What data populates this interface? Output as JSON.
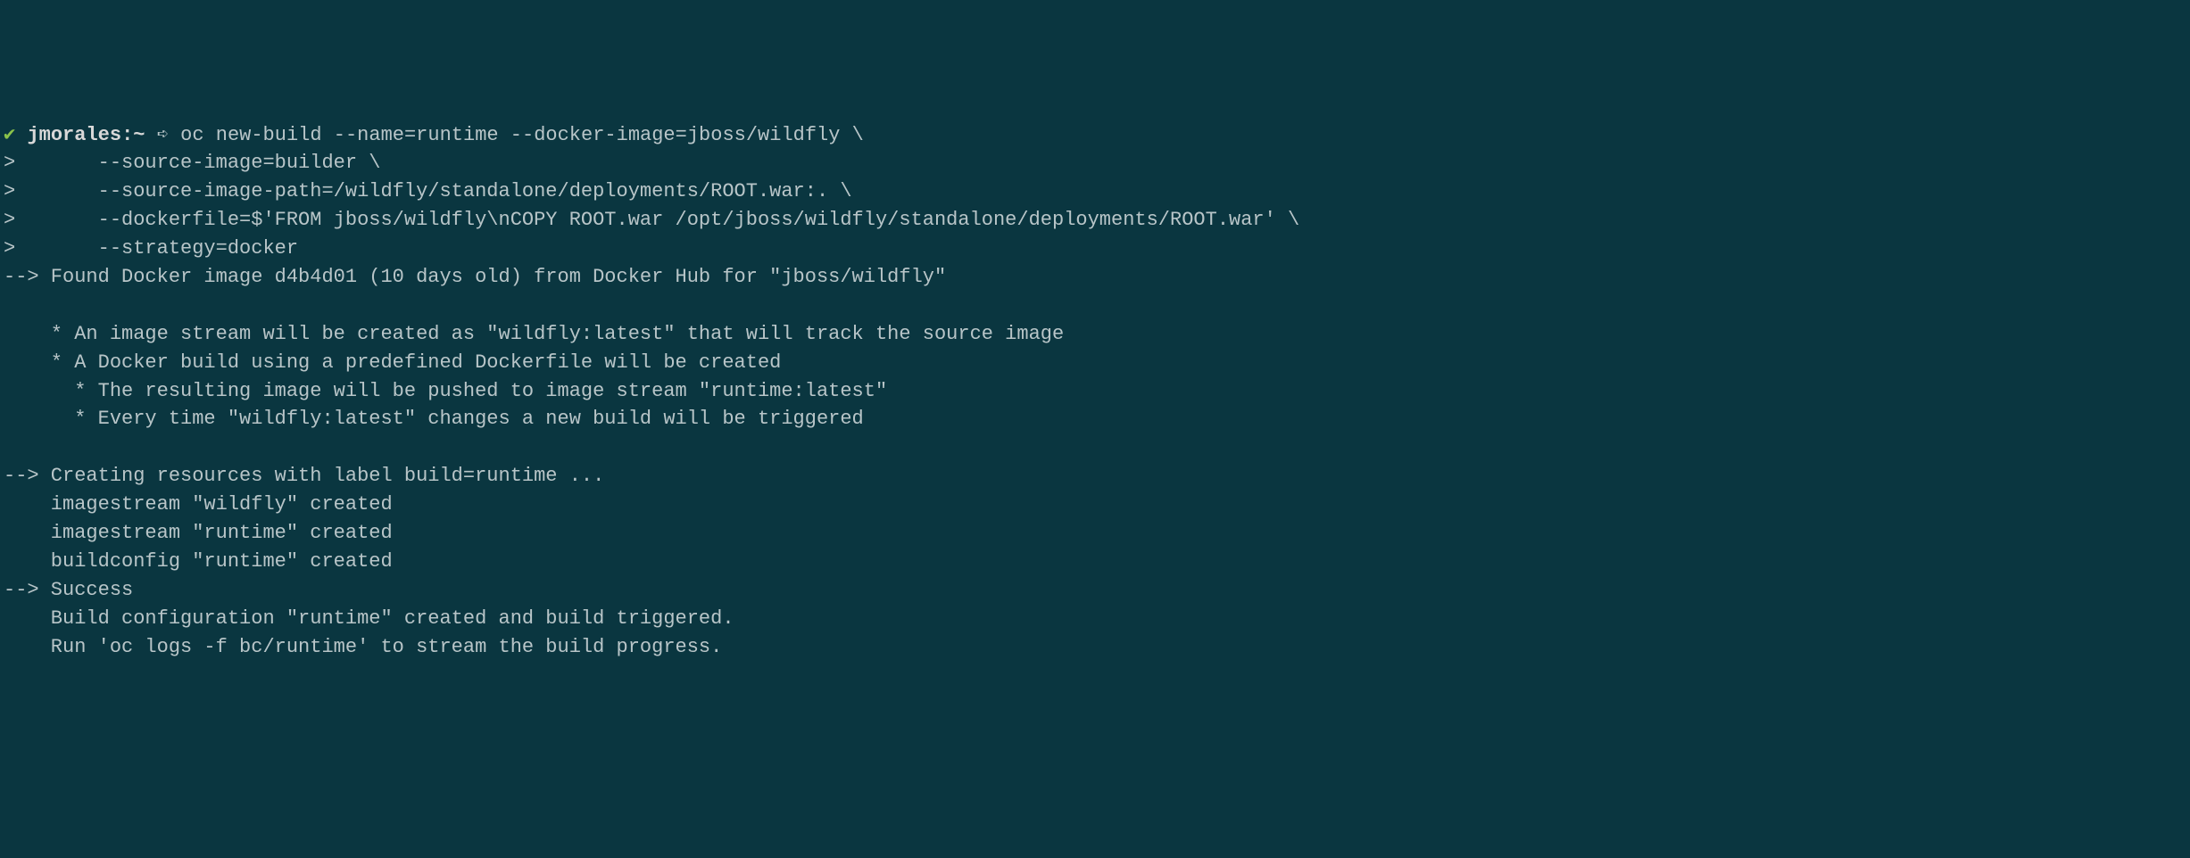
{
  "prompt": {
    "check": "✔",
    "user": "jmorales",
    "separator": ":",
    "path": "~",
    "arrow": "➪"
  },
  "command": {
    "line1": "oc new-build --name=runtime --docker-image=jboss/wildfly \\",
    "line2": ">       --source-image=builder \\",
    "line3": ">       --source-image-path=/wildfly/standalone/deployments/ROOT.war:. \\",
    "line4": ">       --dockerfile=$'FROM jboss/wildfly\\nCOPY ROOT.war /opt/jboss/wildfly/standalone/deployments/ROOT.war' \\",
    "line5": ">       --strategy=docker"
  },
  "output": {
    "found": "--> Found Docker image d4b4d01 (10 days old) from Docker Hub for \"jboss/wildfly\"",
    "blank1": "",
    "bullet1": "    * An image stream will be created as \"wildfly:latest\" that will track the source image",
    "bullet2": "    * A Docker build using a predefined Dockerfile will be created",
    "bullet3": "      * The resulting image will be pushed to image stream \"runtime:latest\"",
    "bullet4": "      * Every time \"wildfly:latest\" changes a new build will be triggered",
    "blank2": "",
    "creating": "--> Creating resources with label build=runtime ...",
    "imagestream1": "    imagestream \"wildfly\" created",
    "imagestream2": "    imagestream \"runtime\" created",
    "buildconfig": "    buildconfig \"runtime\" created",
    "success": "--> Success",
    "buildconf": "    Build configuration \"runtime\" created and build triggered.",
    "runlogs": "    Run 'oc logs -f bc/runtime' to stream the build progress."
  }
}
